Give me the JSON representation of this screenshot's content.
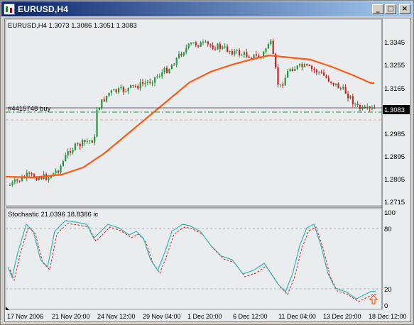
{
  "window": {
    "title": "EURUSD,H4",
    "buttons": {
      "minimize": "_",
      "maximize": "□",
      "close": "×"
    }
  },
  "chart": {
    "header": "EURUSD,H4  1.3073 1.3086 1.3051 1.3083",
    "order_label": "#4415748 buy",
    "current_price": "1.3083",
    "price_ticks": [
      "1.3345",
      "1.3255",
      "1.3165",
      "1.3075",
      "1.2985",
      "1.2895",
      "1.2805",
      "1.2715"
    ],
    "date_ticks": [
      "17 Nov 2006",
      "21 Nov 20:00",
      "24 Nov 12:00",
      "29 Nov 04:00",
      "1 Dec 20:00",
      "6 Dec 12:00",
      "11 Dec 04:00",
      "13 Dec 20:00",
      "18 Dec 12:00"
    ],
    "colors": {
      "bull": "#1e9b3a",
      "bear": "#d42020",
      "ma": "#ff5a14",
      "stoch_main": "#2fb8b8",
      "stoch_signal": "#e02020",
      "order_line": "#1e8c3a"
    }
  },
  "stochastic": {
    "header": "Stochastic  21.0396 18.8386 ic",
    "levels": [
      "100",
      "80",
      "20",
      "0"
    ]
  }
}
